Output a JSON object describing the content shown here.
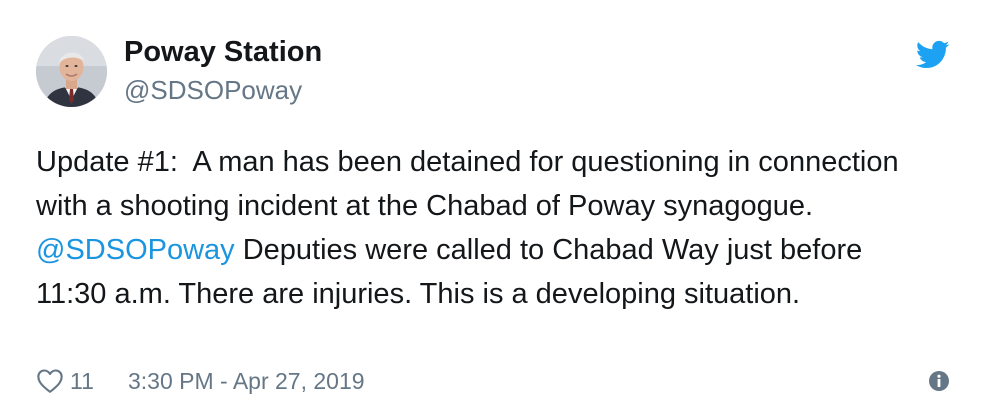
{
  "tweet": {
    "author": {
      "display_name": "Poway Station",
      "handle": "@SDSOPoway",
      "avatar_icon": "profile-photo"
    },
    "text": {
      "part1": "Update #1:  A man has been detained for questioning in connection with a shooting incident at the Chabad of Poway synagogue. ",
      "mention": "@SDSOPoway",
      "part2": " Deputies were called to Chabad Way just before 11:30 a.m. There are injuries. This is a developing situation."
    },
    "footer": {
      "like_icon": "heart-icon",
      "like_count": "11",
      "timestamp": "3:30 PM - Apr 27, 2019",
      "info_icon": "info-icon"
    },
    "logo_icon": "twitter-bird-icon"
  },
  "colors": {
    "text": "#14171a",
    "secondary": "#657786",
    "link": "#1b95e0",
    "twitter_blue": "#1da1f2"
  }
}
